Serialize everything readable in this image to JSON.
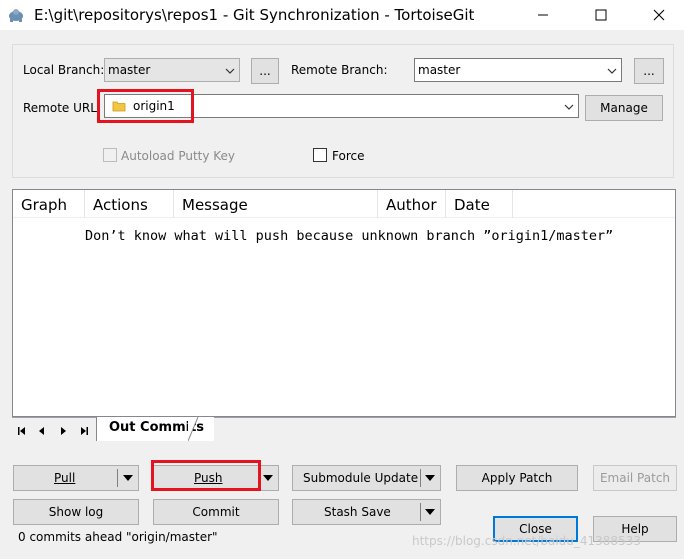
{
  "window": {
    "title": "E:\\git\\repositorys\\repos1 - Git Synchronization - TortoiseGit"
  },
  "form": {
    "local_branch_label": "Local Branch:",
    "local_branch_value": "master",
    "local_browse": "...",
    "remote_branch_label": "Remote Branch:",
    "remote_branch_value": "master",
    "remote_browse": "...",
    "remote_url_label": "Remote URL:",
    "remote_url_value": "origin1",
    "manage_button": "Manage",
    "autoload_label": "Autoload Putty Key",
    "force_label": "Force"
  },
  "list": {
    "columns": [
      "Graph",
      "Actions",
      "Message",
      "Author",
      "Date"
    ],
    "message": "Don’t know what will push because unknown branch ”origin1/master”"
  },
  "tabs": {
    "active": "Out Commits"
  },
  "buttons": {
    "pull": "Pull",
    "push": "Push",
    "submodule_update": "Submodule Update",
    "apply_patch": "Apply Patch",
    "email_patch": "Email Patch",
    "show_log": "Show log",
    "commit": "Commit",
    "stash_save": "Stash Save",
    "close": "Close",
    "help": "Help"
  },
  "status": {
    "text": "0 commits ahead \"origin/master\""
  },
  "watermark": "https://blog.csdn.net/baidu_41388533",
  "colors": {
    "highlight": "#e3141f",
    "default_button_border": "#0078d7"
  }
}
